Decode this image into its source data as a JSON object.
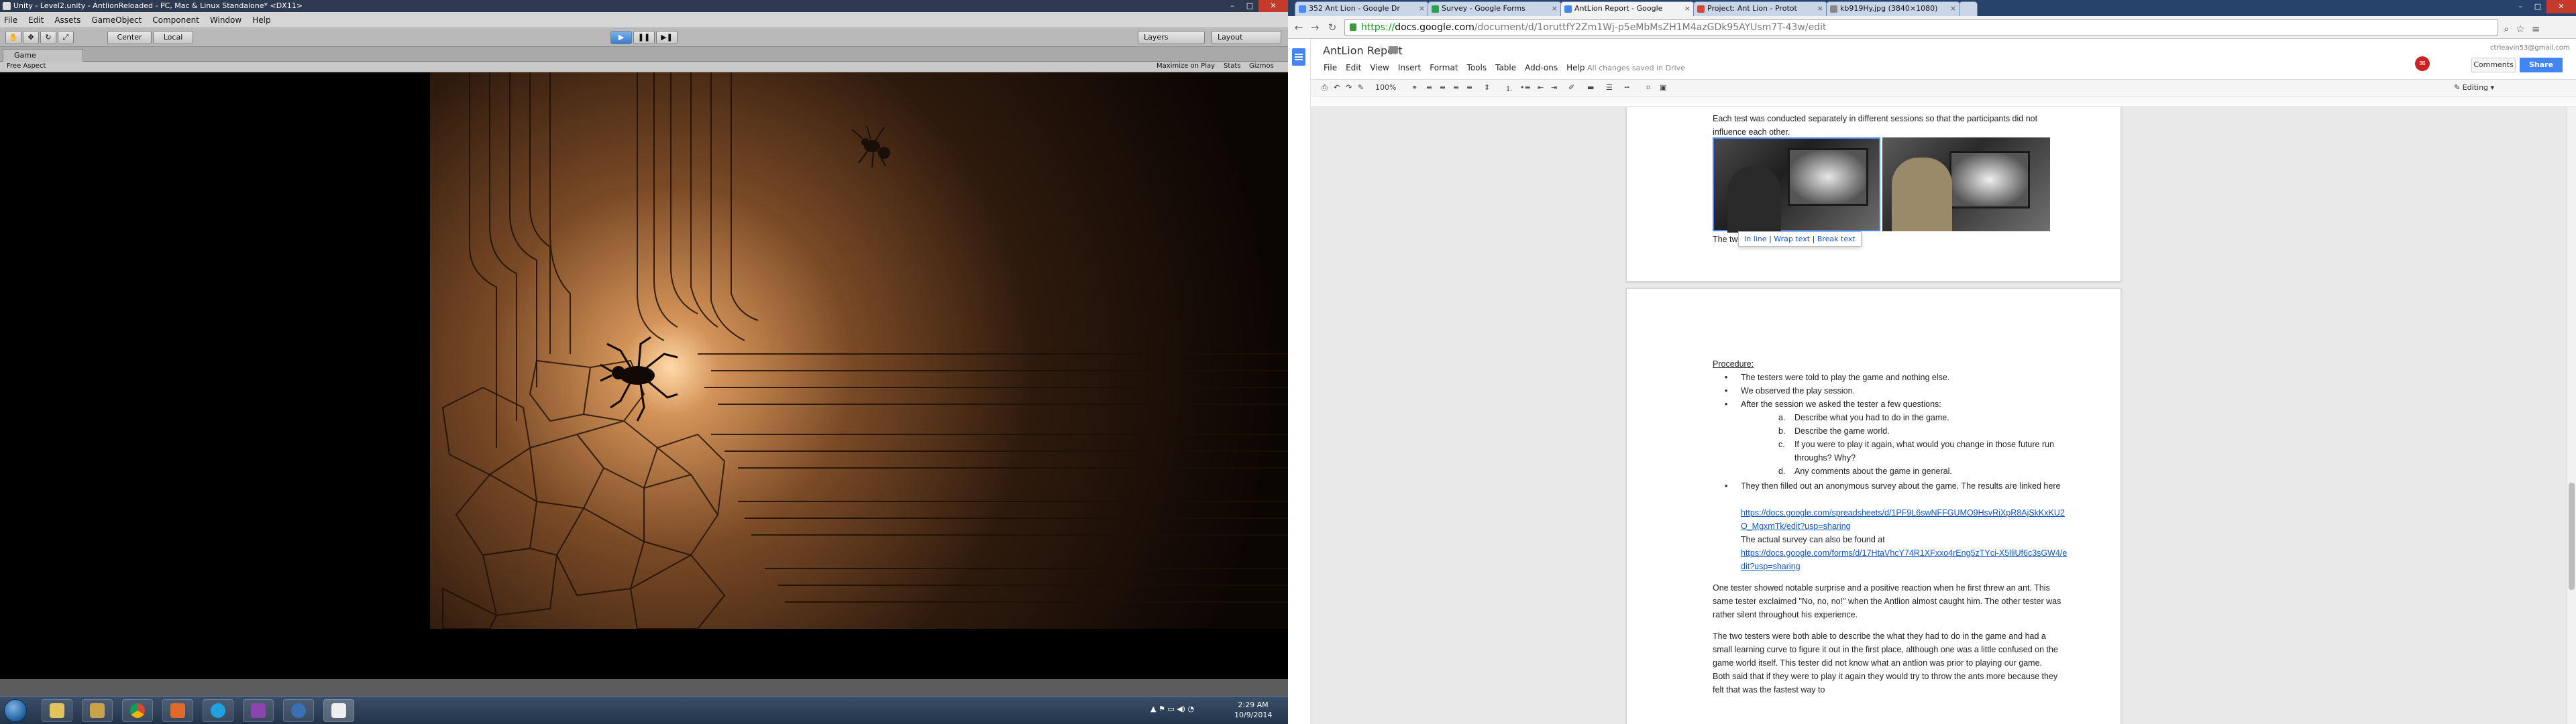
{
  "unity": {
    "title": "Unity - Level2.unity - AntlionReloaded - PC, Mac & Linux Standalone* <DX11>",
    "menu": [
      "File",
      "Edit",
      "Assets",
      "GameObject",
      "Component",
      "Window",
      "Help"
    ],
    "toolbar": {
      "center": "Center",
      "local": "Local",
      "layers": "Layers",
      "layout": "Layout"
    },
    "game_tab": "Game",
    "aspect": "Free Aspect",
    "maximize_on_play": "Maximize on Play",
    "stats": "Stats",
    "gizmos": "Gizmos"
  },
  "taskbar": {
    "clock_time": "2:29 AM",
    "clock_date": "10/9/2014",
    "apps": [
      "file-explorer",
      "libraries",
      "chrome",
      "calculator",
      "skype",
      "onenote",
      "firefox-like",
      "unity"
    ]
  },
  "chrome": {
    "tabs": [
      {
        "label": "352 Ant Lion - Google Dr",
        "favicon_color": "#4a8af4"
      },
      {
        "label": "Survey - Google Forms",
        "favicon_color": "#2e9e4f"
      },
      {
        "label": "AntLion Report - Google",
        "favicon_color": "#4285f4",
        "active": true
      },
      {
        "label": "Project: Ant Lion - Protot",
        "favicon_color": "#d14836"
      },
      {
        "label": "kb919Hy.jpg (3840×1080)",
        "favicon_color": "#888888"
      }
    ],
    "url": {
      "scheme": "https://",
      "host": "docs.google.com",
      "path": "/document/d/1oruttfY2Zm1Wj-p5eMbMsZH1M4azGDk95AYUsm7T-43w/edit"
    }
  },
  "docs": {
    "title": "AntLion Report",
    "menus": [
      "File",
      "Edit",
      "View",
      "Insert",
      "Format",
      "Tools",
      "Table",
      "Add-ons",
      "Help"
    ],
    "saved_status": "All changes saved in Drive",
    "account_email": "ctrleavin53@gmail.com",
    "comments_label": "Comments",
    "share_label": "Share",
    "zoom": "100%",
    "editing_mode": "Editing",
    "page1": {
      "intro": "Each test was conducted separately in different sessions so that the participants did not influence each other.",
      "caption": "The two",
      "popup": {
        "in_line": "In line",
        "wrap": "Wrap text",
        "break": "Break text",
        "sep": " | "
      }
    },
    "page2": {
      "procedure_heading": "Procedure:",
      "bullets": [
        "The testers were told to play the game and nothing else.",
        "We observed the play session.",
        "After the session we asked the tester a few questions:"
      ],
      "questions": [
        {
          "marker": "a.",
          "text": "Describe what you had to do in the game."
        },
        {
          "marker": "b.",
          "text": "Describe the game world."
        },
        {
          "marker": "c.",
          "text": "If you were to play it again, what would you change in those future run throughs? Why?"
        },
        {
          "marker": "d.",
          "text": "Any comments about the game in general."
        }
      ],
      "survey_bullet": "They then filled out an anonymous survey about the game. The results are linked here",
      "results_link": "https://docs.google.com/spreadsheets/d/1PF9L6swNFFGUMO9HsvRiXpR8AjSkKxKU2O_MgxmTk/edit?usp=sharing",
      "survey_found": "The actual survey can also be found at",
      "survey_link": "https://docs.google.com/forms/d/17HtaVhcY74R1XFxxo4rEng5zTYci-X5lliUf6c3sGW4/edit?usp=sharing",
      "para1": "One tester showed notable surprise and a positive reaction when he first threw an ant. This same tester exclaimed \"No, no, no!\" when the Antlion almost caught him. The other tester was rather silent throughout his experience.",
      "para2": "The two testers were both able to describe the what they had to do in the game and had a small learning curve to figure it out in the first place, although one was a little confused on the game world itself. This tester did not know what an antlion was prior to playing our game. Both said that if they were to play it again they would try to throw the ants more because they felt that was the fastest way to"
    }
  }
}
